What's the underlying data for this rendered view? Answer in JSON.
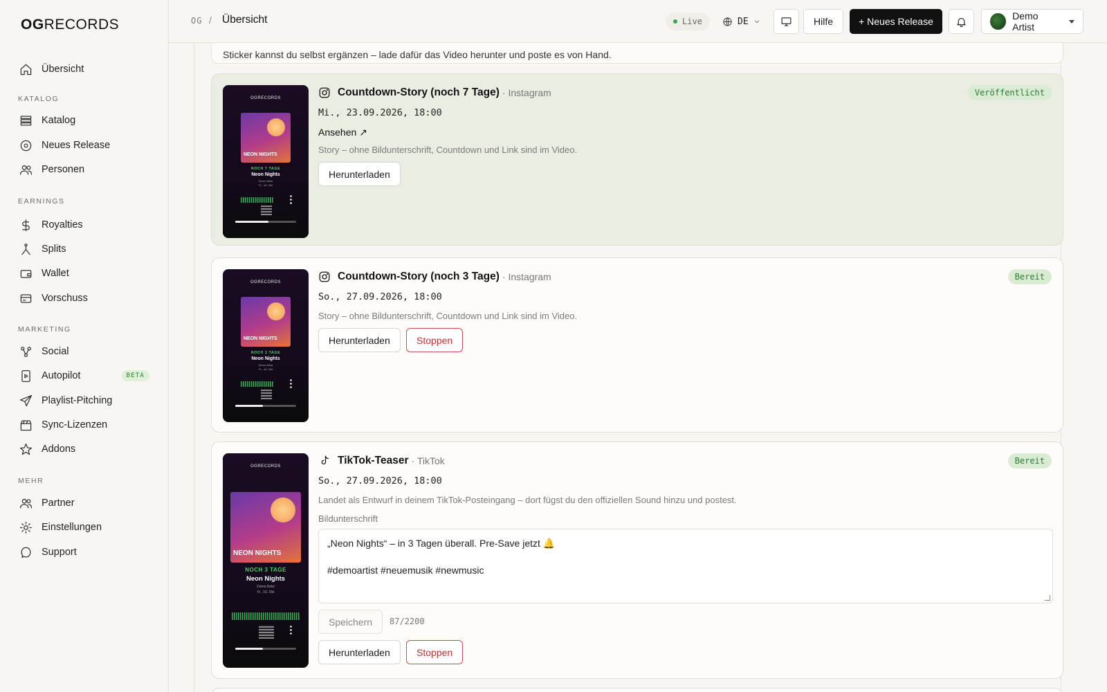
{
  "brand": {
    "logo_bold": "OG",
    "logo_rest": "RECORDS"
  },
  "sidebar": {
    "overview": "Übersicht",
    "sections": {
      "katalog": "KATALOG",
      "earnings": "EARNINGS",
      "marketing": "MARKETING",
      "mehr": "MEHR"
    },
    "items": {
      "katalog": "Katalog",
      "neues_release": "Neues Release",
      "personen": "Personen",
      "royalties": "Royalties",
      "splits": "Splits",
      "wallet": "Wallet",
      "vorschuss": "Vorschuss",
      "social": "Social",
      "autopilot": "Autopilot",
      "autopilot_badge": "BETA",
      "playlist": "Playlist-Pitching",
      "sync": "Sync-Lizenzen",
      "addons": "Addons",
      "partner": "Partner",
      "einstellungen": "Einstellungen",
      "support": "Support"
    }
  },
  "header": {
    "crumb_root": "OG",
    "crumb_sep": "/",
    "title": "Übersicht",
    "live": "Live",
    "language": "DE",
    "help": "Hilfe",
    "new_release": "+ Neues Release",
    "user": "Demo Artist"
  },
  "intro_text": "Sticker kannst du selbst ergänzen – lade dafür das Video herunter und poste es von Hand.",
  "cards": [
    {
      "title": "Countdown-Story (noch 7 Tage)",
      "platform": "· Instagram",
      "status": "Veröffentlicht",
      "date": "Mi., 23.09.2026, 18:00",
      "link": "Ansehen ↗",
      "note": "Story – ohne Bildunterschrift, Countdown und Link sind im Video.",
      "download": "Herunterladen",
      "thumb_days": "NOCH 7 TAGE",
      "thumb_progress": 0.55
    },
    {
      "title": "Countdown-Story (noch 3 Tage)",
      "platform": "· Instagram",
      "status": "Bereit",
      "date": "So., 27.09.2026, 18:00",
      "note": "Story – ohne Bildunterschrift, Countdown und Link sind im Video.",
      "download": "Herunterladen",
      "stop": "Stoppen",
      "thumb_days": "NOCH 3 TAGE",
      "thumb_progress": 0.45
    },
    {
      "title": "TikTok-Teaser",
      "platform": "· TikTok",
      "status": "Bereit",
      "date": "So., 27.09.2026, 18:00",
      "note": "Landet als Entwurf in deinem TikTok-Posteingang – dort fügst du den offiziellen Sound hinzu und postest.",
      "caption_label": "Bildunterschrift",
      "caption_line1": "„Neon Nights“ – in 3 Tagen überall. Pre-Save jetzt 🔔",
      "caption_line2": "#demoartist #neuemusik #newmusic",
      "save": "Speichern",
      "char_count": "87/2200",
      "download": "Herunterladen",
      "stop": "Stoppen",
      "thumb_days": "NOCH 3 TAGE",
      "thumb_progress": 0.45
    }
  ],
  "thumb": {
    "brand": "OGRECORDS",
    "art_title": "NEON NIGHTS",
    "track": "Neon Nights",
    "artist": "Demo Artist",
    "date": "Fr., 16. Okt"
  },
  "colors": {
    "accent_green": "#2e7a34",
    "stop_red": "#c22f2f",
    "published_bg": "#eaede2"
  }
}
